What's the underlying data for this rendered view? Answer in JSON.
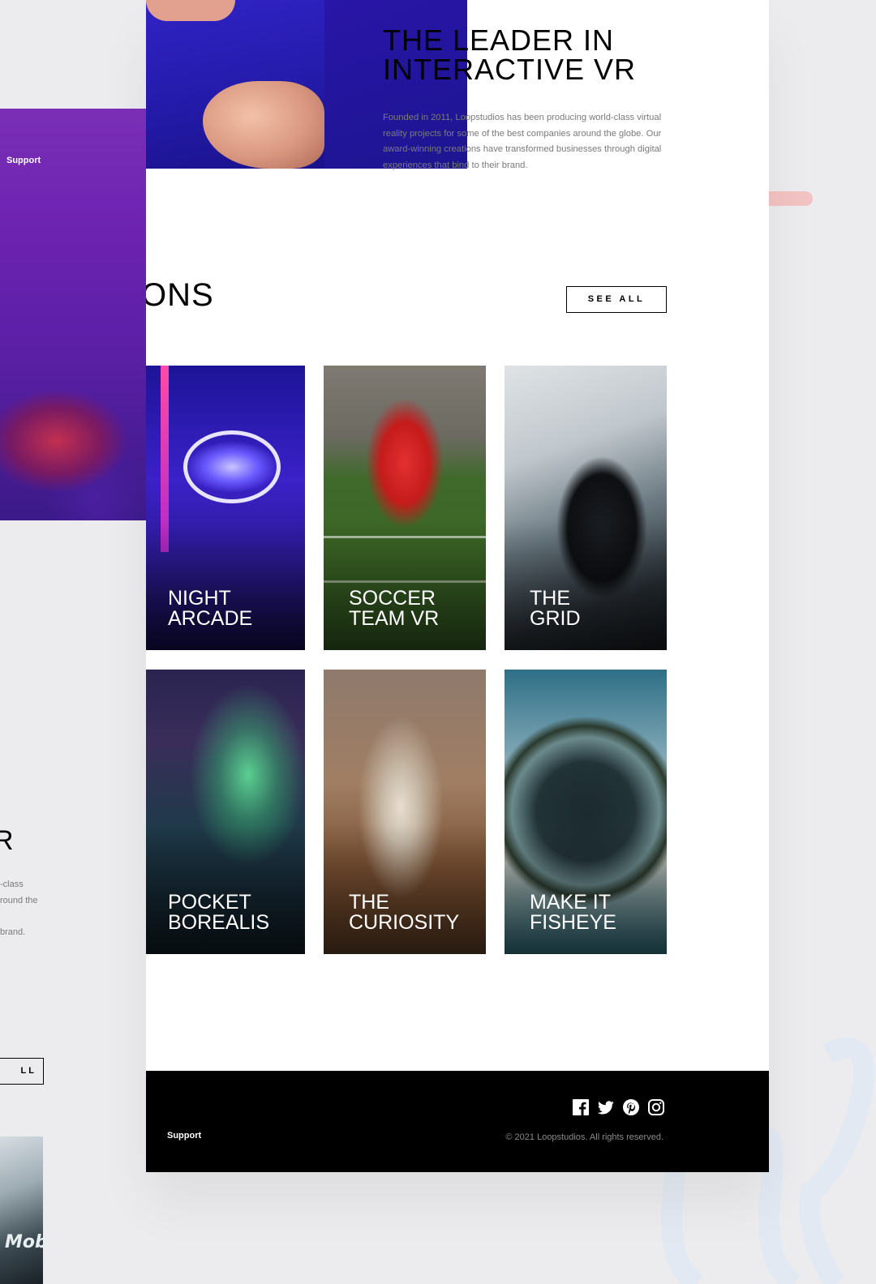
{
  "about": {
    "title": "THE LEADER IN INTERACTIVE VR",
    "body": "Founded in 2011, Loopstudios has been producing world-class virtual reality projects for some of the best companies around the globe. Our award-winning creations have transformed businesses through digital experiences that bind to their brand."
  },
  "creations": {
    "heading": "ONS",
    "see_all": "SEE ALL",
    "cards": [
      {
        "label": "NIGHT\nARCADE"
      },
      {
        "label": "SOCCER\nTEAM VR"
      },
      {
        "label": "THE\nGRID"
      },
      {
        "label": "POCKET\nBOREALIS"
      },
      {
        "label": "THE\nCURIOSITY"
      },
      {
        "label": "MAKE IT\nFISHEYE"
      }
    ]
  },
  "footer": {
    "link_support": "Support",
    "copyright": "© 2021 Loopstudios. All rights reserved.",
    "socials": [
      "facebook-icon",
      "twitter-icon",
      "pinterest-icon",
      "instagram-icon"
    ]
  },
  "mobile": {
    "nav_support": "Support",
    "fragment_r": "R",
    "fragment_text_1": "-class",
    "fragment_text_2": "round the",
    "fragment_text_3": "brand.",
    "fragment_button": "LL",
    "fragment_card_text": "Mob"
  },
  "colors": {
    "page_bg": "#ececee",
    "footer_bg": "#000000",
    "accent_pill": "#f3c2c3"
  }
}
